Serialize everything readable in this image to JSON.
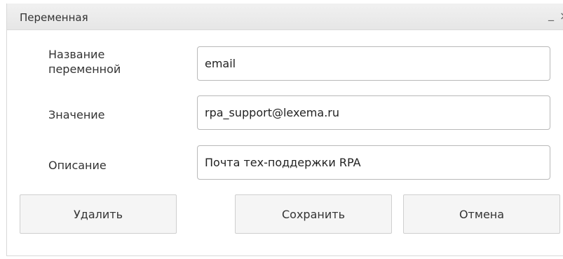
{
  "dialog": {
    "title": "Переменная",
    "minimize_glyph": "_",
    "close_glyph": "×"
  },
  "form": {
    "name_label": "Название переменной",
    "name_value": "email",
    "value_label": "Значение",
    "value_value": "rpa_support@lexema.ru",
    "description_label": "Описание",
    "description_value": "Почта тех-поддержки RPA"
  },
  "buttons": {
    "delete_label": "Удалить",
    "save_label": "Сохранить",
    "cancel_label": "Отмена"
  }
}
